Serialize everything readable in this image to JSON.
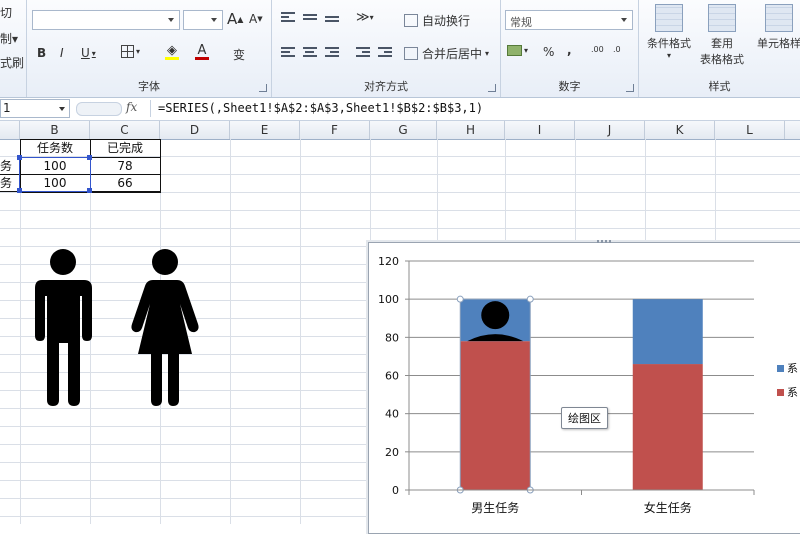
{
  "ribbon": {
    "clipboard": {
      "cut": "切",
      "copy": "制",
      "format_painter": "式刷"
    },
    "font": {
      "label": "字体",
      "font_name": "",
      "font_size": "",
      "grow": "A",
      "shrink": "A",
      "bold": "B",
      "italic": "I",
      "underline": "U",
      "font_color": "A",
      "phonetic": "变"
    },
    "alignment": {
      "label": "对齐方式",
      "wrap_text": "自动换行",
      "merge_center": "合并后居中"
    },
    "number": {
      "label": "数字",
      "format": "常规",
      "percent": "%",
      "comma": ","
    },
    "styles": {
      "label": "样式",
      "conditional": "条件格式",
      "table_format_1": "套用",
      "table_format_2": "表格格式",
      "cell_styles": "单元格样"
    }
  },
  "formula_bar": {
    "name_box": "1",
    "fx": "fx",
    "formula": "=SERIES(,Sheet1!$A$2:$A$3,Sheet1!$B$2:$B$3,1)"
  },
  "columns": [
    "B",
    "C",
    "D",
    "E",
    "F",
    "G",
    "H",
    "I",
    "J",
    "K",
    "L"
  ],
  "table": {
    "headers": [
      "任务数",
      "已完成"
    ],
    "rows": [
      {
        "label": "务",
        "b": "100",
        "c": "78"
      },
      {
        "label": "务",
        "b": "100",
        "c": "66"
      }
    ]
  },
  "chart_data": {
    "type": "bar",
    "stacked": true,
    "categories": [
      "男生任务",
      "女生任务"
    ],
    "series": [
      {
        "name": "系",
        "values": [
          78,
          66
        ],
        "color": "#c0504d"
      },
      {
        "name": "系",
        "values": [
          22,
          34
        ],
        "color": "#4f81bd"
      }
    ],
    "ylim": [
      0,
      120
    ],
    "yticks": [
      "0",
      "20",
      "40",
      "60",
      "80",
      "100",
      "120"
    ],
    "grid": true,
    "legend": "right",
    "tooltip": "绘图区"
  },
  "icons": [
    "male-figure-icon",
    "female-figure-icon"
  ],
  "colors": {
    "series_red": "#c0504d",
    "series_blue": "#4f81bd",
    "selection": "#3355cc"
  }
}
